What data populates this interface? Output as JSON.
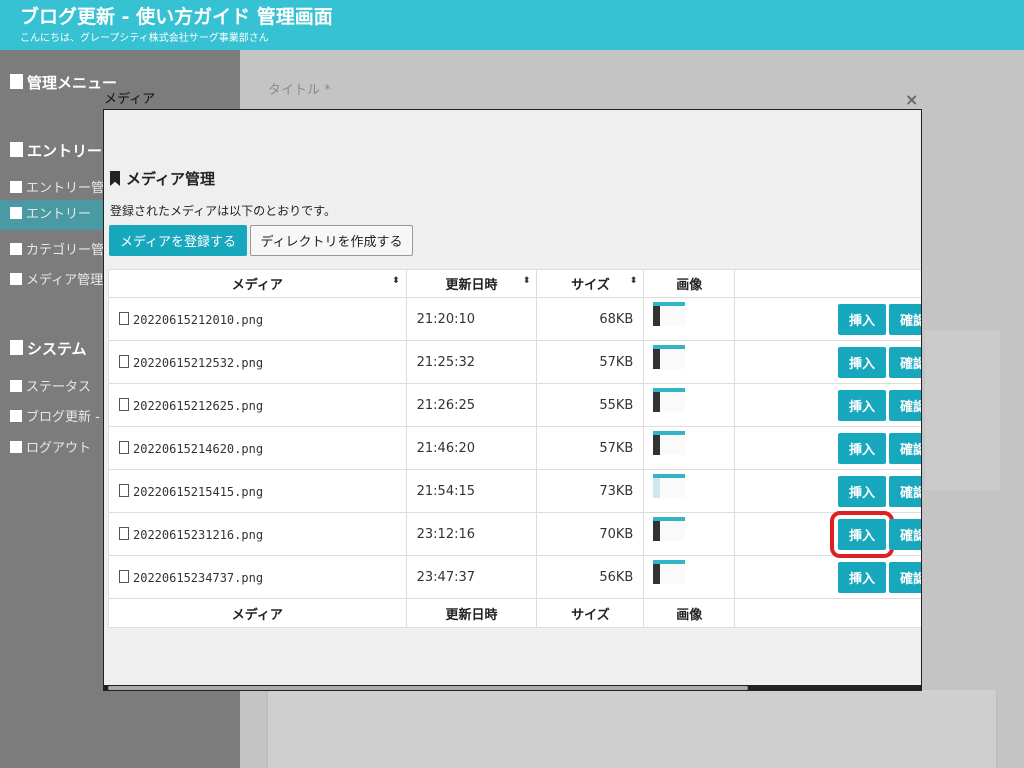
{
  "background": {
    "header_title": "ブログ更新 - 使い方ガイド 管理画面",
    "header_subtitle": "こんにちは、グレープシティ株式会社サーグ事業部さん",
    "title_label": "タイトル *",
    "sidebar": {
      "admin_menu": "管理メニュー",
      "entries_section": "エントリー",
      "entries_items": [
        "エントリー管",
        "エントリー",
        "カテゴリー管",
        "メディア管理"
      ],
      "system_section": "システム",
      "system_items": [
        "ステータス",
        "ブログ更新 -",
        "ログアウト"
      ]
    }
  },
  "modal": {
    "label": "メディア",
    "close": "×",
    "heading": "メディア管理",
    "description": "登録されたメディアは以下のとおりです。",
    "register_button": "メディアを登録する",
    "create_dir_button": "ディレクトリを作成する",
    "columns": {
      "media": "メディア",
      "date": "更新日時",
      "size": "サイズ",
      "image": "画像"
    },
    "sort_icon": "⬍",
    "insert_label": "挿入",
    "confirm_label": "確認",
    "rows": [
      {
        "name": "20220615212010.png",
        "time": "21:20:10",
        "size": "68KB"
      },
      {
        "name": "20220615212532.png",
        "time": "21:25:32",
        "size": "57KB"
      },
      {
        "name": "20220615212625.png",
        "time": "21:26:25",
        "size": "55KB"
      },
      {
        "name": "20220615214620.png",
        "time": "21:46:20",
        "size": "57KB"
      },
      {
        "name": "20220615215415.png",
        "time": "21:54:15",
        "size": "73KB"
      },
      {
        "name": "20220615231216.png",
        "time": "23:12:16",
        "size": "70KB"
      },
      {
        "name": "20220615234737.png",
        "time": "23:47:37",
        "size": "56KB"
      }
    ],
    "highlight_row": 5
  },
  "colors": {
    "accent": "#18a8bd",
    "header": "#36c2d3",
    "highlight": "#e02020"
  }
}
